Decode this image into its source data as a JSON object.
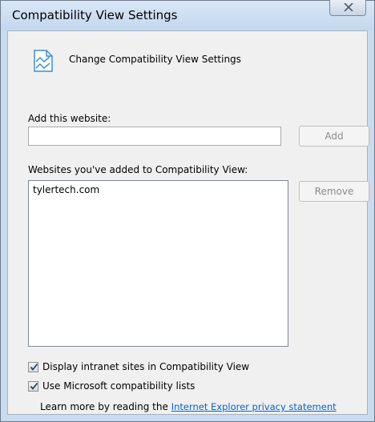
{
  "window": {
    "title": "Compatibility View Settings"
  },
  "header": {
    "text": "Change Compatibility View Settings"
  },
  "add_section": {
    "label": "Add this website:",
    "input_value": "",
    "add_button": "Add"
  },
  "list_section": {
    "label": "Websites you've added to Compatibility View:",
    "items": [
      "tylertech.com"
    ],
    "remove_button": "Remove"
  },
  "options": {
    "intranet_label": "Display intranet sites in Compatibility View",
    "intranet_checked": true,
    "ms_lists_label": "Use Microsoft compatibility lists",
    "ms_lists_checked": true
  },
  "learn_more": {
    "prefix": "Learn more by reading the",
    "link": "Internet Explorer privacy statement"
  },
  "icons": {
    "header": "compatibility-page-icon",
    "close": "close-icon",
    "check": "checkmark-icon"
  },
  "colors": {
    "titlebar": "#c4d7ee",
    "link": "#0066cc",
    "disabled_text": "#8b8b8b"
  }
}
